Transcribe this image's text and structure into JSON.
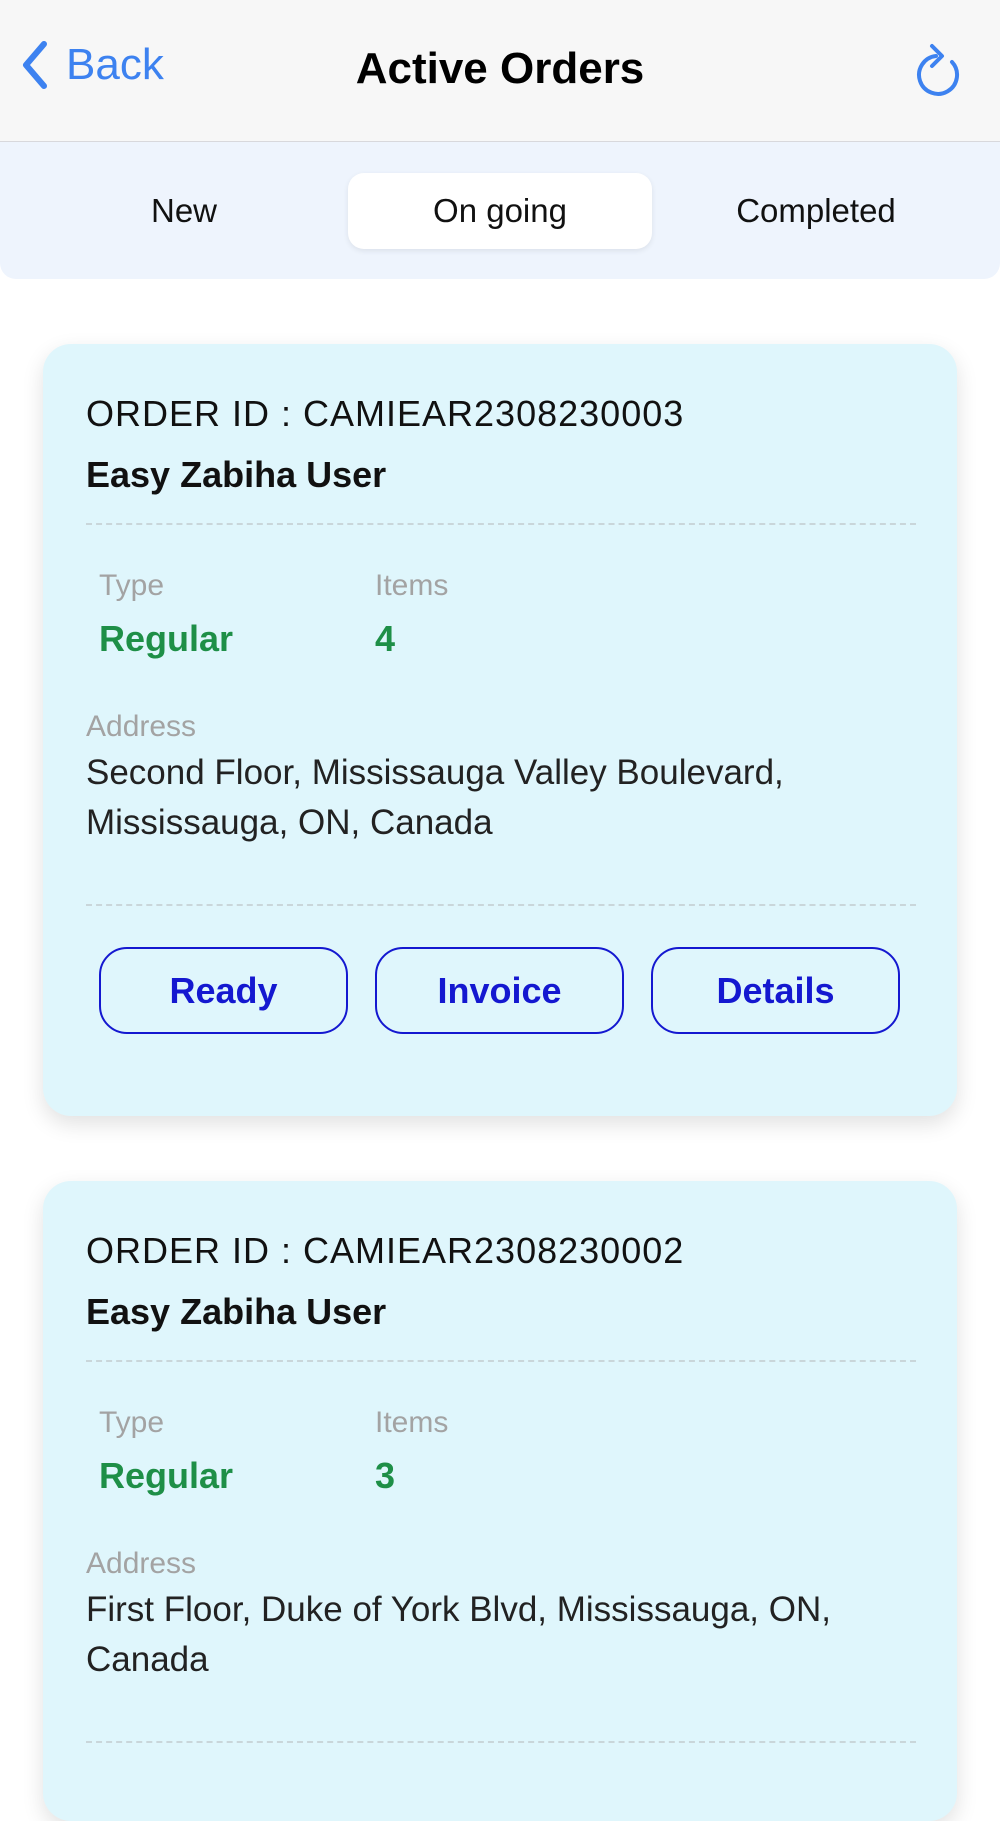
{
  "nav": {
    "back_label": "Back",
    "title": "Active Orders",
    "accent_color": "#3d82f0"
  },
  "tabs": [
    {
      "label": "New",
      "active": false
    },
    {
      "label": "On going",
      "active": true
    },
    {
      "label": "Completed",
      "active": false
    }
  ],
  "orders": [
    {
      "order_id": "ORDER ID : CAMIEAR2308230003",
      "user": "Easy Zabiha User",
      "type_label": "Type",
      "type_value": "Regular",
      "items_label": "Items",
      "items_value": "4",
      "address_label": "Address",
      "address": "Second Floor, Mississauga Valley Boulevard, Mississauga, ON, Canada",
      "buttons": [
        "Ready",
        "Invoice",
        "Details"
      ]
    },
    {
      "order_id": "ORDER ID : CAMIEAR2308230002",
      "user": "Easy Zabiha User",
      "type_label": "Type",
      "type_value": "Regular",
      "items_label": "Items",
      "items_value": "3",
      "address_label": "Address",
      "address": "First Floor, Duke of York Blvd, Mississauga, ON, Canada"
    }
  ],
  "colors": {
    "card_bg": "#dff6fc",
    "value_green": "#1e8f47",
    "button_blue": "#1418d0"
  }
}
